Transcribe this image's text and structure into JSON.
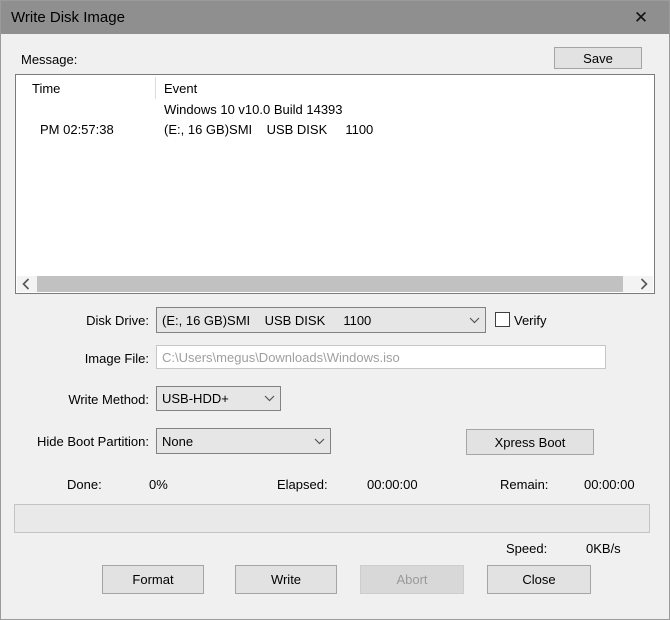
{
  "window": {
    "title": "Write Disk Image"
  },
  "icons": {
    "close": "✕"
  },
  "message": {
    "label": "Message:",
    "save_button": "Save"
  },
  "log": {
    "columns": {
      "time": "Time",
      "event": "Event"
    },
    "rows": [
      {
        "time": "",
        "event": "Windows 10 v10.0 Build 14393"
      },
      {
        "time": "PM 02:57:38",
        "event": "(E:, 16 GB)SMI    USB DISK     1100"
      }
    ]
  },
  "form": {
    "disk_drive": {
      "label": "Disk Drive:",
      "value": "(E:, 16 GB)SMI    USB DISK     1100"
    },
    "verify": {
      "label": "Verify",
      "checked": false
    },
    "image_file": {
      "label": "Image File:",
      "value": "C:\\Users\\megus\\Downloads\\Windows.iso"
    },
    "write_method": {
      "label": "Write Method:",
      "value": "USB-HDD+"
    },
    "hide_boot_partition": {
      "label": "Hide Boot Partition:",
      "value": "None"
    },
    "xpress_boot_button": "Xpress Boot"
  },
  "progress": {
    "done_label": "Done:",
    "done_value": "0%",
    "elapsed_label": "Elapsed:",
    "elapsed_value": "00:00:00",
    "remain_label": "Remain:",
    "remain_value": "00:00:00",
    "percent": 0,
    "speed_label": "Speed:",
    "speed_value": "0KB/s"
  },
  "buttons": {
    "format": "Format",
    "write": "Write",
    "abort": "Abort",
    "close": "Close"
  }
}
